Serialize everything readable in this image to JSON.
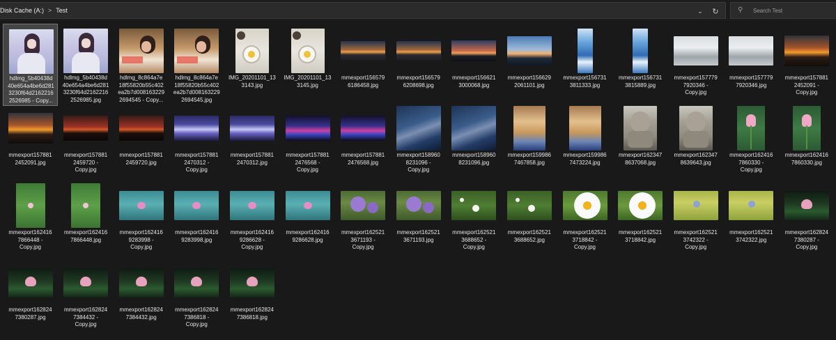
{
  "address": {
    "root": "Disk Cache (A:)",
    "folder": "Test"
  },
  "search": {
    "placeholder": "Search Test"
  },
  "files": [
    {
      "name": "hdlmg_5b40438d\n40e654a4be6d281\n3230f64d2162216\n2526985 - Copy...",
      "selected": true,
      "thumb": "girl-illustration"
    },
    {
      "name": "hdlmg_5b40438d\n40e654a4be6d281\n3230f64d2162216\n2526985.jpg",
      "thumb": "girl-illustration"
    },
    {
      "name": "hdlmg_8c864a7e\n18f55820b55c402\nea2b7d008163229\n2694545 - Copy...",
      "thumb": "woman-dining"
    },
    {
      "name": "hdlmg_8c864a7e\n18f55820b55c402\nea2b7d008163229\n2694545.jpg",
      "thumb": "woman-dining"
    },
    {
      "name": "IMG_20201101_13\n3143.jpg",
      "thumb": "cup-portrait"
    },
    {
      "name": "IMG_20201101_13\n3145.jpg",
      "thumb": "cup-portrait"
    },
    {
      "name": "mmexport156579\n6186458.jpg",
      "thumb": "sunset-panorama"
    },
    {
      "name": "mmexport156579\n6208698.jpg",
      "thumb": "sunset-panorama"
    },
    {
      "name": "mmexport156621\n3000068.jpg",
      "thumb": "city-sunset"
    },
    {
      "name": "mmexport156629\n2061101.jpg",
      "thumb": "city-night"
    },
    {
      "name": "mmexport156731\n3811333.jpg",
      "thumb": "sky-strip"
    },
    {
      "name": "mmexport156731\n3815889.jpg",
      "thumb": "sky-strip"
    },
    {
      "name": "mmexport157779\n7920346 -\nCopy.jpg",
      "thumb": "frost-trees"
    },
    {
      "name": "mmexport157779\n7920346.jpg",
      "thumb": "frost-trees"
    },
    {
      "name": "mmexport157881\n2452091 -\nCopy.jpg",
      "thumb": "sunset-orange"
    },
    {
      "name": "mmexport157881\n2452091.jpg",
      "thumb": "sunset-orange"
    },
    {
      "name": "mmexport157881\n2459720 -\nCopy.jpg",
      "thumb": "sunset-red"
    },
    {
      "name": "mmexport157881\n2459720.jpg",
      "thumb": "sunset-red"
    },
    {
      "name": "mmexport157881\n2470312 -\nCopy.jpg",
      "thumb": "fountain-show"
    },
    {
      "name": "mmexport157881\n2470312.jpg",
      "thumb": "fountain-show"
    },
    {
      "name": "mmexport157881\n2476568 -\nCopy.jpg",
      "thumb": "light-show"
    },
    {
      "name": "mmexport157881\n2476568.jpg",
      "thumb": "light-show"
    },
    {
      "name": "mmexport158960\n8231096 -\nCopy.jpg",
      "thumb": "milky-way"
    },
    {
      "name": "mmexport158960\n8231096.jpg",
      "thumb": "milky-way"
    },
    {
      "name": "mmexport159986\n7467858.jpg",
      "thumb": "temple-interior"
    },
    {
      "name": "mmexport159986\n7473224.jpg",
      "thumb": "temple-interior"
    },
    {
      "name": "mmexport162347\n8637068.jpg",
      "thumb": "stone-statue"
    },
    {
      "name": "mmexport162347\n8639643.jpg",
      "thumb": "stone-statue"
    },
    {
      "name": "mmexport162416\n7860330 -\nCopy.jpg",
      "thumb": "lotus-bud"
    },
    {
      "name": "mmexport162416\n7860330.jpg",
      "thumb": "lotus-bud"
    },
    {
      "name": "mmexport162416\n7866448 -\nCopy.jpg",
      "thumb": "lotus-leaves"
    },
    {
      "name": "mmexport162416\n7866448.jpg",
      "thumb": "lotus-leaves"
    },
    {
      "name": "mmexport162416\n9283998 -\nCopy.jpg",
      "thumb": "teal-lily"
    },
    {
      "name": "mmexport162416\n9283998.jpg",
      "thumb": "teal-lily"
    },
    {
      "name": "mmexport162416\n9286628 -\nCopy.jpg",
      "thumb": "teal-lily"
    },
    {
      "name": "mmexport162416\n9286628.jpg",
      "thumb": "teal-lily"
    },
    {
      "name": "mmexport162521\n3671193 -\nCopy.jpg",
      "thumb": "purple-flowers"
    },
    {
      "name": "mmexport162521\n3671193.jpg",
      "thumb": "purple-flowers"
    },
    {
      "name": "mmexport162521\n3688652 -\nCopy.jpg",
      "thumb": "white-flowers-field"
    },
    {
      "name": "mmexport162521\n3688652.jpg",
      "thumb": "white-flowers-field"
    },
    {
      "name": "mmexport162521\n3718842 -\nCopy.jpg",
      "thumb": "daisy"
    },
    {
      "name": "mmexport162521\n3718842.jpg",
      "thumb": "daisy"
    },
    {
      "name": "mmexport162521\n3742322 -\nCopy.jpg",
      "thumb": "yellow-field"
    },
    {
      "name": "mmexport162521\n3742322.jpg",
      "thumb": "yellow-field"
    },
    {
      "name": "mmexport162824\n7380287 -\nCopy.jpg",
      "thumb": "lotus-dark"
    },
    {
      "name": "mmexport162824\n7380287.jpg",
      "thumb": "lotus-dark"
    },
    {
      "name": "mmexport162824\n7384432 -\nCopy.jpg",
      "thumb": "lotus-dark"
    },
    {
      "name": "mmexport162824\n7384432.jpg",
      "thumb": "lotus-dark"
    },
    {
      "name": "mmexport162824\n7386818 -\nCopy.jpg",
      "thumb": "lotus-dark"
    },
    {
      "name": "mmexport162824\n7386818.jpg",
      "thumb": "lotus-dark"
    }
  ]
}
